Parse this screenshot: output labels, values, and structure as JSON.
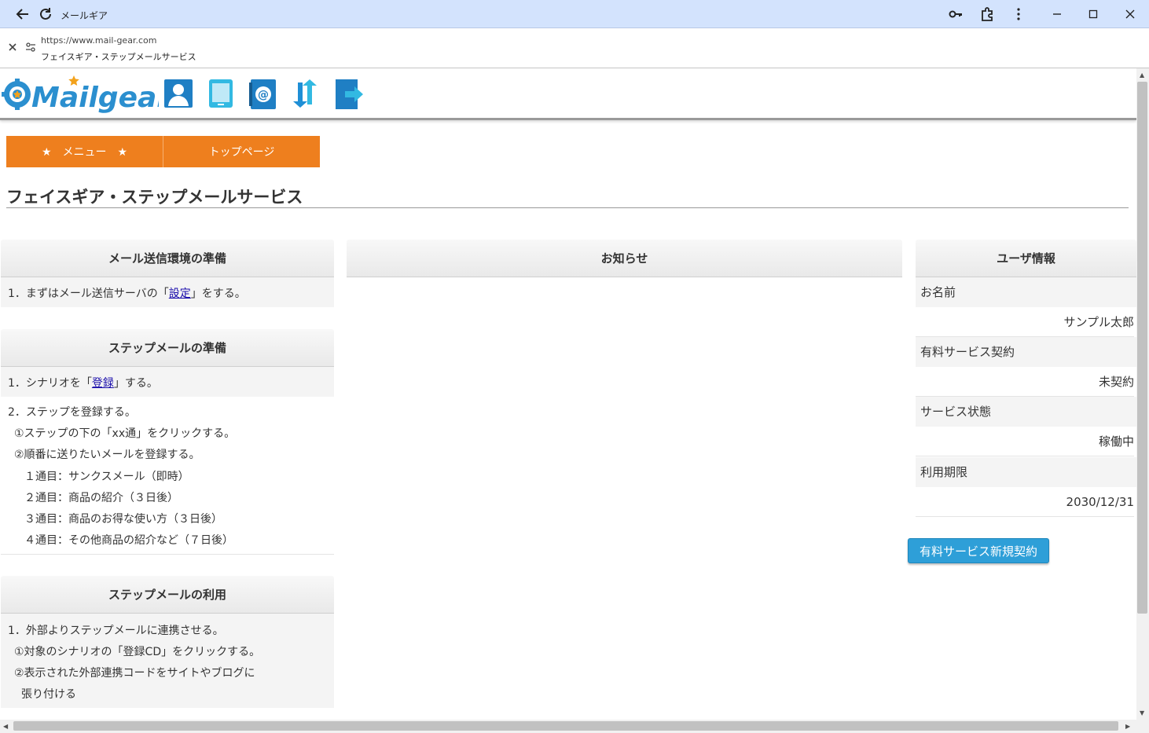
{
  "window": {
    "title": "メールギア"
  },
  "address": {
    "url": "https://www.mail-gear.com",
    "page_title": "フェイスギア・ステップメールサービス"
  },
  "logo": {
    "text": "Mailgear"
  },
  "nav_icons": [
    "user-icon",
    "tablet-icon",
    "address-book-icon",
    "sync-icon",
    "logout-icon"
  ],
  "orange_nav": {
    "menu_label": "★　メニュー　★",
    "top_label": "トップページ"
  },
  "page": {
    "heading": "フェイスギア・ステップメールサービス"
  },
  "left": {
    "prep_mail": {
      "title": "メール送信環境の準備",
      "line1_prefix": "1．まずはメール送信サーバの「",
      "line1_link": "設定",
      "line1_suffix": "」をする。"
    },
    "prep_step": {
      "title": "ステップメールの準備",
      "line1_prefix": "1．シナリオを「",
      "line1_link": "登録",
      "line1_suffix": "」する。",
      "lines": [
        "2．ステップを登録する。",
        "①ステップの下の「xx通」をクリックする。",
        "②順番に送りたいメールを登録する。",
        "１通目：サンクスメール（即時）",
        "２通目：商品の紹介（３日後）",
        "３通目：商品のお得な使い方（３日後）",
        "４通目：その他商品の紹介など（７日後）"
      ]
    },
    "use_step": {
      "title": "ステップメールの利用",
      "lines": [
        "1．外部よりステップメールに連携させる。",
        "①対象のシナリオの「登録CD」をクリックする。",
        "②表示された外部連携コードをサイトやブログに",
        "張り付ける"
      ]
    }
  },
  "center": {
    "title": "お知らせ"
  },
  "right": {
    "title": "ユーザ情報",
    "rows": [
      {
        "label": "お名前",
        "value": "サンプル太郎"
      },
      {
        "label": "有料サービス契約",
        "value": "未契約"
      },
      {
        "label": "サービス状態",
        "value": "稼働中"
      },
      {
        "label": "利用期限",
        "value": "2030/12/31"
      }
    ],
    "button": "有料サービス新規契約"
  },
  "colors": {
    "accent_orange": "#ee7f1e",
    "button_blue": "#2e9fd8",
    "titlebar": "#d3e3fd"
  }
}
